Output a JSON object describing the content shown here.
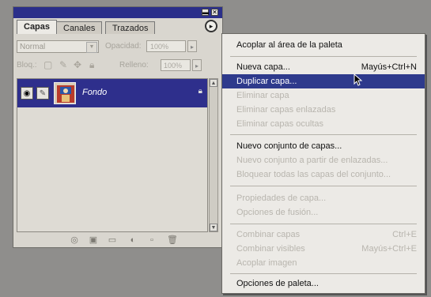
{
  "palette": {
    "tabs": [
      "Capas",
      "Canales",
      "Trazados"
    ],
    "blend_mode": "Normal",
    "opacity_label": "Opacidad:",
    "opacity_value": "100%",
    "lock_label": "Bloq.:",
    "fill_label": "Relleno:",
    "fill_value": "100%",
    "layer_name": "Fondo"
  },
  "menu": {
    "items": [
      {
        "label": "Acoplar al área de la paleta",
        "shortcut": "",
        "state": "enabled"
      },
      {
        "label": "Nueva capa...",
        "shortcut": "Mayús+Ctrl+N",
        "state": "enabled"
      },
      {
        "label": "Duplicar capa...",
        "shortcut": "",
        "state": "highlighted"
      },
      {
        "label": "Eliminar capa",
        "shortcut": "",
        "state": "disabled"
      },
      {
        "label": "Eliminar capas enlazadas",
        "shortcut": "",
        "state": "disabled"
      },
      {
        "label": "Eliminar capas ocultas",
        "shortcut": "",
        "state": "disabled"
      },
      {
        "label": "Nuevo conjunto de capas...",
        "shortcut": "",
        "state": "enabled"
      },
      {
        "label": "Nuevo conjunto a partir de enlazadas...",
        "shortcut": "",
        "state": "disabled"
      },
      {
        "label": "Bloquear todas las capas del conjunto...",
        "shortcut": "",
        "state": "disabled"
      },
      {
        "label": "Propiedades de capa...",
        "shortcut": "",
        "state": "disabled"
      },
      {
        "label": "Opciones de fusión...",
        "shortcut": "",
        "state": "disabled"
      },
      {
        "label": "Combinar capas",
        "shortcut": "Ctrl+E",
        "state": "disabled"
      },
      {
        "label": "Combinar visibles",
        "shortcut": "Mayús+Ctrl+E",
        "state": "disabled"
      },
      {
        "label": "Acoplar imagen",
        "shortcut": "",
        "state": "disabled"
      },
      {
        "label": "Opciones de paleta...",
        "shortcut": "",
        "state": "enabled"
      }
    ]
  },
  "colors": {
    "highlight": "#2e3a8c",
    "title_bar": "#2b2f8a",
    "disabled_text": "#b8b5ae"
  },
  "icons": [
    "eye-icon",
    "brush-icon",
    "lock-icon",
    "palette-menu-icon",
    "link-icon",
    "layer-style-icon",
    "mask-icon",
    "new-set-icon",
    "adjustment-icon",
    "new-layer-icon",
    "trash-icon",
    "mouse-cursor-icon"
  ]
}
